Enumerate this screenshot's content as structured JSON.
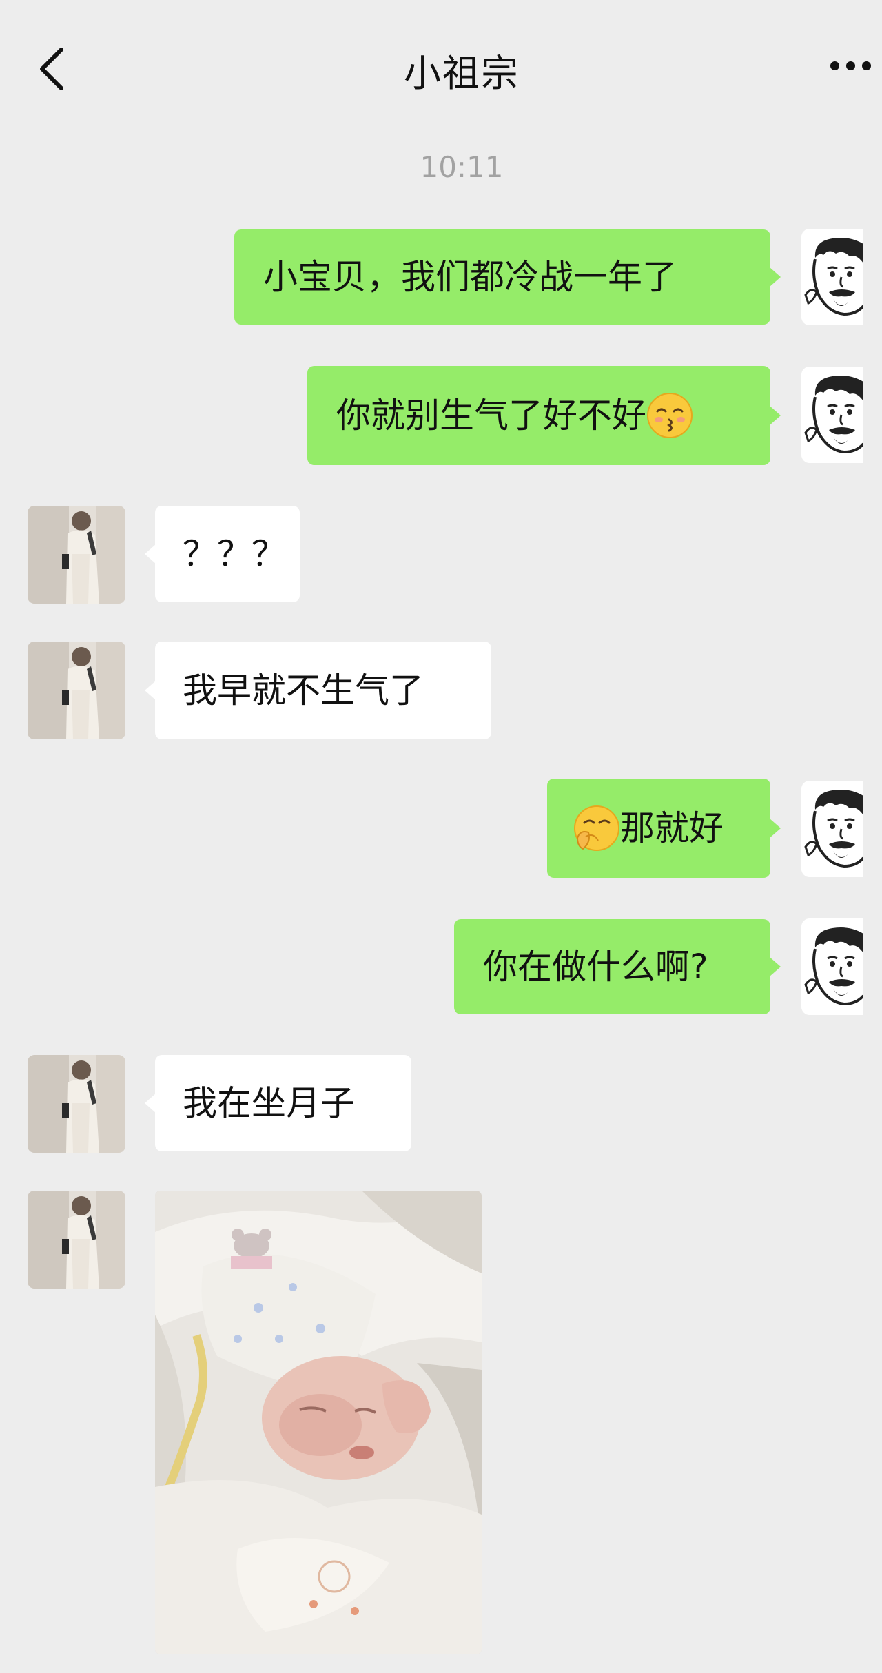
{
  "header": {
    "title": "小祖宗",
    "back_icon": "chevron-left-icon",
    "more_icon": "more-dots-icon"
  },
  "timestamp": "10:11",
  "messages": [
    {
      "side": "out",
      "text": "小宝贝，我们都冷战一年了",
      "emoji": ""
    },
    {
      "side": "out",
      "text": "你就别生气了好不好",
      "emoji": "kissing-face-icon"
    },
    {
      "side": "in",
      "text": "？？？"
    },
    {
      "side": "in",
      "text": "我早就不生气了"
    },
    {
      "side": "out",
      "text": "那就好",
      "emoji": "hand-over-mouth-face-icon"
    },
    {
      "side": "out",
      "text": "你在做什么啊?"
    },
    {
      "side": "in",
      "text": "我在坐月子"
    },
    {
      "side": "in",
      "type": "image",
      "image": "newborn-baby-photo"
    }
  ],
  "colors": {
    "background": "#ededed",
    "outgoing_bubble": "#95ec69",
    "incoming_bubble": "#ffffff",
    "timestamp": "#a2a2a2"
  }
}
